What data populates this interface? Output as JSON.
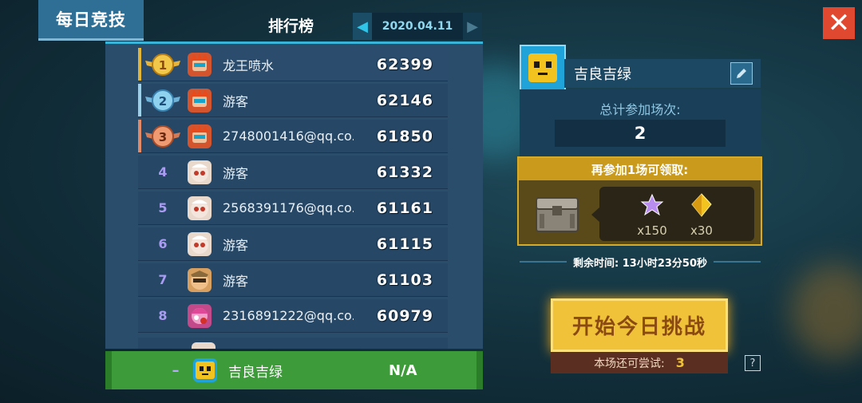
{
  "header": {
    "mode_tab": "每日竞技",
    "leaderboard_title": "排行榜",
    "date": "2020.04.11",
    "close_label": "✕"
  },
  "leaderboard": {
    "rows": [
      {
        "rank": "1",
        "name": "龙王喷水",
        "score": "62399",
        "medal": "gold"
      },
      {
        "rank": "2",
        "name": "游客",
        "score": "62146",
        "medal": "silver"
      },
      {
        "rank": "3",
        "name": "2748001416@qq.co...",
        "score": "61850",
        "medal": "bronze"
      },
      {
        "rank": "4",
        "name": "游客",
        "score": "61332",
        "medal": ""
      },
      {
        "rank": "5",
        "name": "2568391176@qq.co...",
        "score": "61161",
        "medal": ""
      },
      {
        "rank": "6",
        "name": "游客",
        "score": "61115",
        "medal": ""
      },
      {
        "rank": "7",
        "name": "游客",
        "score": "61103",
        "medal": ""
      },
      {
        "rank": "8",
        "name": "2316891222@qq.co...",
        "score": "60979",
        "medal": ""
      }
    ],
    "my_row": {
      "rank": "–",
      "name": "吉良吉绿",
      "score": "N/A"
    }
  },
  "profile": {
    "name": "吉良吉绿",
    "total_label": "总计参加场次:",
    "total_value": "2"
  },
  "reward": {
    "header": "再参加1场可领取:",
    "items": [
      {
        "icon": "purple-star-icon",
        "qty": "x150"
      },
      {
        "icon": "gold-diamond-icon",
        "qty": "x30"
      }
    ]
  },
  "timer": {
    "text": "剩余时间:  13小时23分50秒"
  },
  "start_button": "开始今日挑战",
  "attempts": {
    "label": "本场还可尝试:",
    "value": "3"
  },
  "help_label": "?",
  "colors": {
    "accent": "#2fc4e8",
    "start": "#f0c23a",
    "close": "#e0482f",
    "self_row": "#3e9b39"
  }
}
